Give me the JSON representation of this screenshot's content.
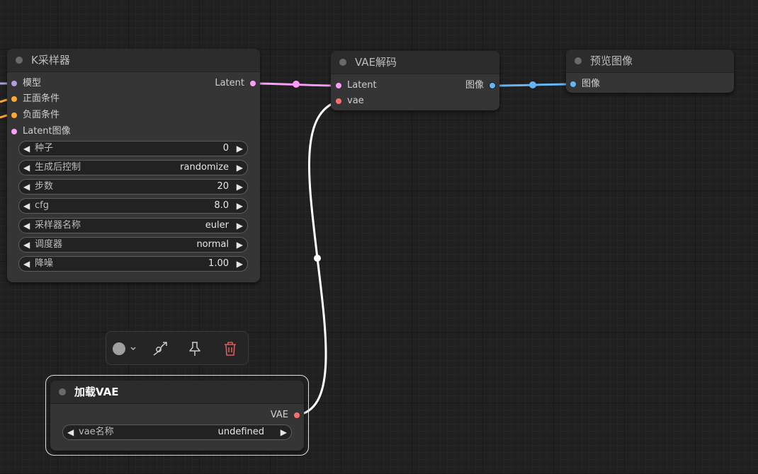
{
  "nodes": {
    "ksampler": {
      "title": "K采样器",
      "inputs": [
        "模型",
        "正面条件",
        "负面条件",
        "Latent图像"
      ],
      "output": "Latent",
      "widgets": [
        {
          "name": "种子",
          "value": "0"
        },
        {
          "name": "生成后控制",
          "value": "randomize"
        },
        {
          "name": "步数",
          "value": "20"
        },
        {
          "name": "cfg",
          "value": "8.0"
        },
        {
          "name": "采样器名称",
          "value": "euler"
        },
        {
          "name": "调度器",
          "value": "normal"
        },
        {
          "name": "降噪",
          "value": "1.00"
        }
      ]
    },
    "vae_decode": {
      "title": "VAE解码",
      "inputs": [
        "Latent",
        "vae"
      ],
      "output": "图像"
    },
    "preview_image": {
      "title": "预览图像",
      "inputs": [
        "图像"
      ]
    },
    "load_vae": {
      "title": "加载VAE",
      "output": "VAE",
      "widget": {
        "name": "vae名称",
        "value": "undefined"
      }
    }
  },
  "widget_arrows": {
    "left": "◀",
    "right": "▶"
  },
  "colors": {
    "model": "#b39ddb",
    "conditioning": "#ffa931",
    "latent": "#ff9cf9",
    "vae": "#ff6e6e",
    "image": "#64b5f6",
    "vae_wire": "#ffffff"
  },
  "toolbar": {
    "icons": [
      "color-picker-icon",
      "bypass-icon",
      "pin-icon",
      "trash-icon"
    ]
  }
}
